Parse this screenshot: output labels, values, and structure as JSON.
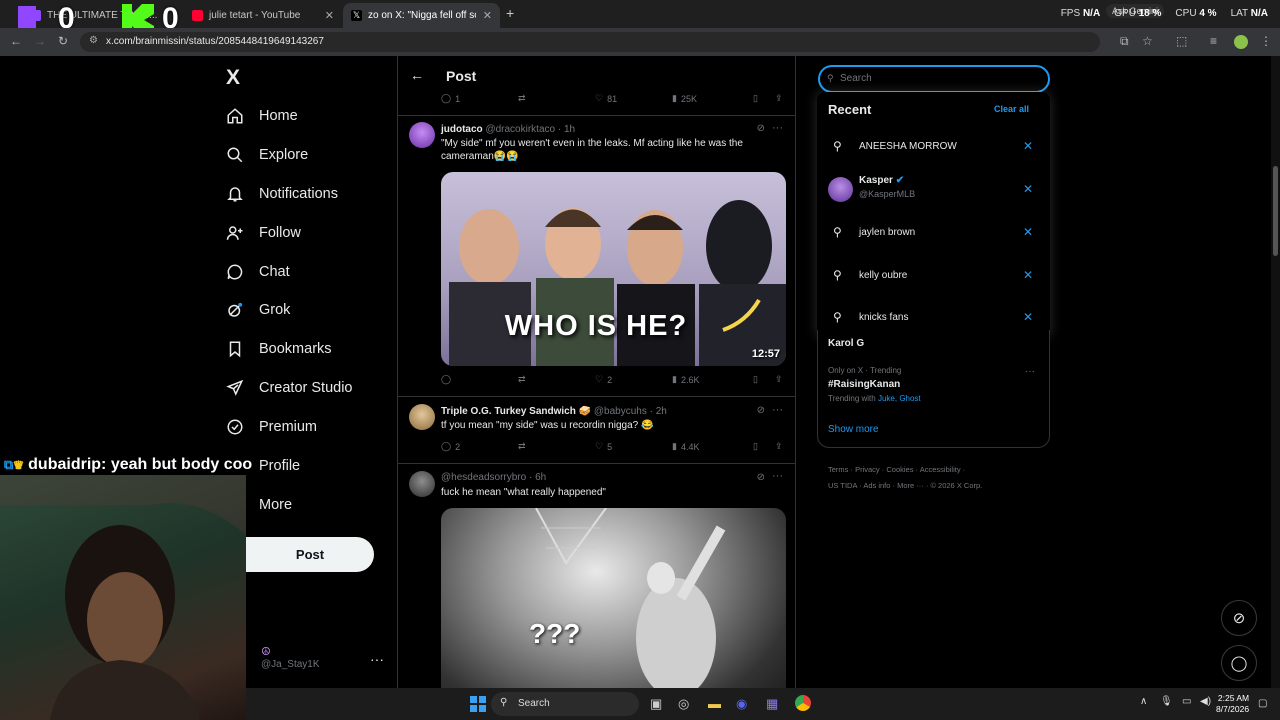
{
  "browser": {
    "tabs": [
      {
        "title": "THE ULTIMATE TRAVI..."
      },
      {
        "title": "julie tetart - YouTube"
      },
      {
        "title": "zo on X: \"Nigga fell off so hard"
      }
    ],
    "url": "x.com/brainmissin/status/2085448419649143267",
    "ask_gemini": "Ask Gemini",
    "perf": {
      "fps_label": "FPS",
      "fps": "N/A",
      "gpu_label": "GPU",
      "gpu": "18 %",
      "cpu_label": "CPU",
      "cpu": "4 %",
      "lat_label": "LAT",
      "lat": "N/A"
    }
  },
  "overlay": {
    "score_left": "0",
    "score_right": "0",
    "chat_user": "dubaidrip",
    "chat_msg": ": yeah but body coo"
  },
  "nav": {
    "logo": "X",
    "items": [
      {
        "label": "Home",
        "icon": "home-icon"
      },
      {
        "label": "Explore",
        "icon": "search-icon"
      },
      {
        "label": "Notifications",
        "icon": "bell-icon"
      },
      {
        "label": "Follow",
        "icon": "person-add-icon"
      },
      {
        "label": "Chat",
        "icon": "chat-icon"
      },
      {
        "label": "Grok",
        "icon": "grok-icon"
      },
      {
        "label": "Bookmarks",
        "icon": "bookmark-icon"
      },
      {
        "label": "Creator Studio",
        "icon": "rocket-icon"
      },
      {
        "label": "Premium",
        "icon": "verified-icon"
      },
      {
        "label": "Profile",
        "icon": "profile-icon"
      },
      {
        "label": "More",
        "icon": "more-icon"
      }
    ],
    "post_button": "Post",
    "account_handle": "@Ja_Stay1K"
  },
  "timeline": {
    "header": "Post",
    "top_actions": {
      "replies": "1",
      "likes": "81",
      "views": "25K"
    },
    "posts": [
      {
        "name": "judotaco",
        "handle": "@dracokirktaco",
        "time": "· 1h",
        "text": "\"My side\" mf you weren't even in the leaks. Mf acting like he was the cameraman😭😭",
        "media_caption": "WHO IS HE?",
        "media_duration": "12:57",
        "likes": "2",
        "views": "2.6K"
      },
      {
        "name": "Triple O.G. Turkey Sandwich 🥪",
        "handle": "@babycuhs",
        "time": "· 2h",
        "text": "tf you mean \"my side\" was u recordin nigga? 😂",
        "replies": "2",
        "likes": "5",
        "views": "4.4K"
      },
      {
        "name": "",
        "handle": "@hesdeadsorrybro",
        "time": "· 6h",
        "text": "fuck he mean \"what really happened\"",
        "media_caption": "???"
      }
    ]
  },
  "search": {
    "placeholder": "Search",
    "recent_title": "Recent",
    "clear_all": "Clear all",
    "recent": [
      {
        "type": "query",
        "text": "ANEESHA MORROW"
      },
      {
        "type": "user",
        "name": "Kasper",
        "handle": "@KasperMLB"
      },
      {
        "type": "query",
        "text": "jaylen brown"
      },
      {
        "type": "query",
        "text": "kelly oubre"
      },
      {
        "type": "query",
        "text": "knicks fans"
      }
    ]
  },
  "trends": {
    "partial_title": "Karol G",
    "trend_meta": "Only on X · Trending",
    "trend_name": "#RaisingKanan",
    "trending_with_label": "Trending with",
    "trending_with": "Juke, Ghost",
    "show_more": "Show more"
  },
  "footer": {
    "links": [
      "Terms",
      "Privacy",
      "Cookies",
      "Accessibility",
      "US TIDA",
      "Ads info",
      "More ···",
      "© 2026 X Corp."
    ]
  },
  "taskbar": {
    "search_label": "Search",
    "time": "2:25 AM",
    "date": "8/7/2026"
  },
  "colors": {
    "accent": "#1d9bf0",
    "bg": "#000000",
    "border": "#2f3336",
    "muted": "#71767b"
  }
}
